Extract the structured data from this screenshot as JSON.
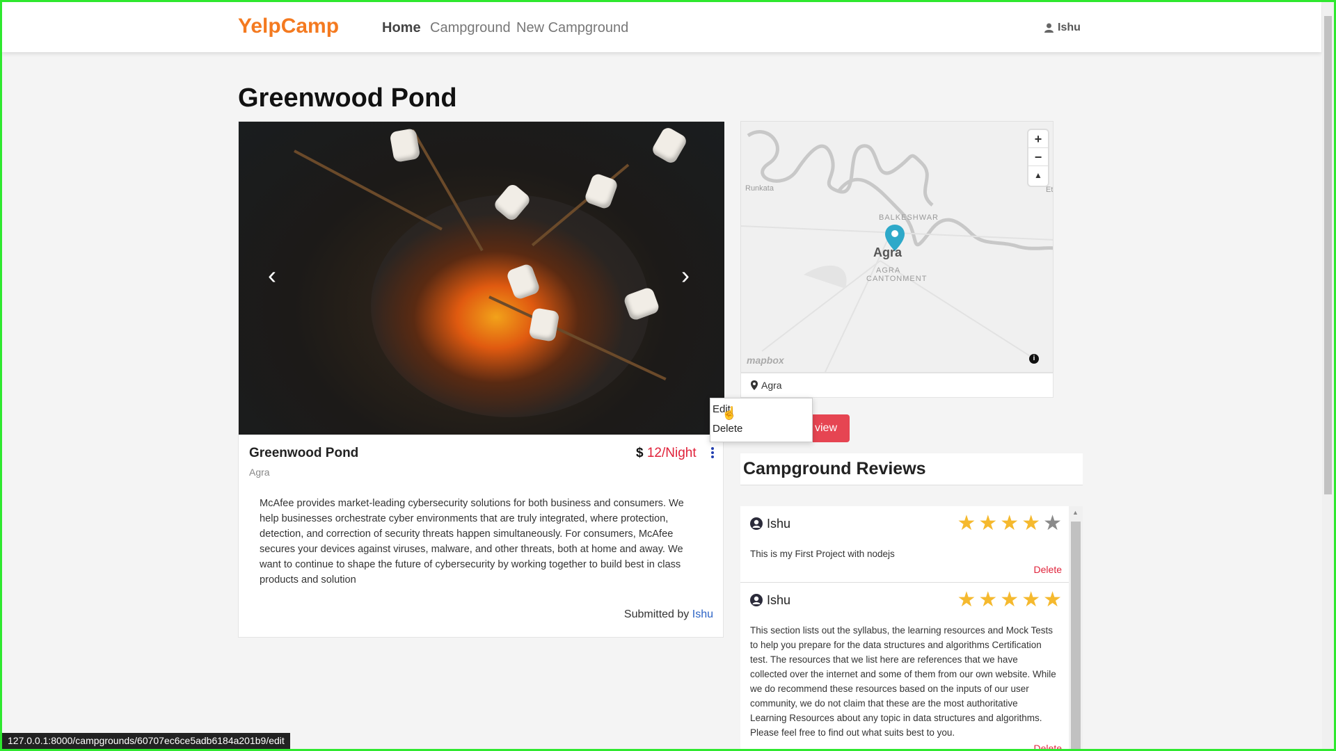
{
  "navbar": {
    "brand": "YelpCamp",
    "links": [
      {
        "label": "Home",
        "active": true
      },
      {
        "label": "Campground",
        "active": false
      },
      {
        "label": "New Campground",
        "active": false
      }
    ],
    "user": "Ishu"
  },
  "page_title": "Greenwood Pond",
  "campground": {
    "title": "Greenwood Pond",
    "price_symbol": "$",
    "price": "12/Night",
    "location": "Agra",
    "description": "McAfee provides market-leading cybersecurity solutions for both business and consumers. We help businesses orchestrate cyber environments that are truly integrated, where protection, detection, and correction of security threats happen simultaneously. For consumers, McAfee secures your devices against viruses, malware, and other threats, both at home and away. We want to continue to shape the future of cybersecurity by working together to build best in class products and solution",
    "submitted_prefix": "Submitted by",
    "submitted_by": "Ishu"
  },
  "map": {
    "labels": [
      "Runkata",
      "BALKESHWAR",
      "AGRA",
      "CANTONMENT",
      "Et"
    ],
    "city": "Agra",
    "attribution": "mapbox",
    "footer_location": "Agra",
    "zoom_in": "+",
    "zoom_out": "−",
    "compass": "▲"
  },
  "dropdown": {
    "items": [
      "Edit",
      "Delete"
    ]
  },
  "review_button": "view",
  "reviews_title": "Campground Reviews",
  "reviews": [
    {
      "user": "Ishu",
      "rating": 4,
      "max_rating": 5,
      "text": "This is my First Project with nodejs",
      "delete_label": "Delete"
    },
    {
      "user": "Ishu",
      "rating": 5,
      "max_rating": 5,
      "text": "This section lists out the syllabus, the learning resources and Mock Tests to help you prepare for the data structures and algorithms Certification test. The resources that we list here are references that we have collected over the internet and some of them from our own website. While we do recommend these resources based on the inputs of our user community, we do not claim that these are the most authoritative Learning Resources about any topic in data structures and algorithms. Please feel free to find out what suits best to you.",
      "delete_label": "Delete"
    }
  ],
  "status_bar_url": "127.0.0.1:8000/campgrounds/60707ec6ce5adb6184a201b9/edit",
  "colors": {
    "brand": "#f47a20",
    "price": "#e0223a",
    "star": "#f5b92e",
    "danger_button": "#e64552",
    "link": "#2c63c5",
    "frame_border": "#2ee82e"
  },
  "icons": [
    "user-icon",
    "chevron-left-icon",
    "chevron-right-icon",
    "kebab-menu-icon",
    "map-pin-icon",
    "info-icon",
    "user-circle-icon",
    "star-icon",
    "cursor-icon"
  ]
}
